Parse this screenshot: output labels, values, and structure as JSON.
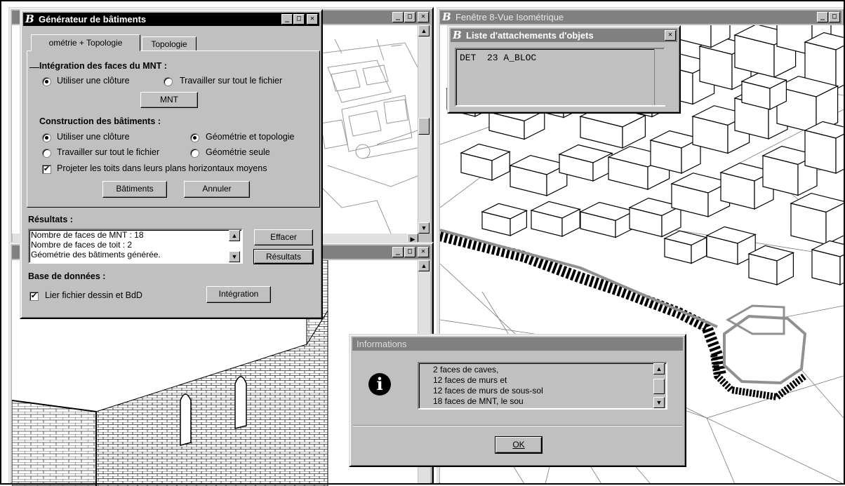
{
  "generator": {
    "title": "Générateur de bâtiments",
    "tabs": [
      "ométrie + Topologie",
      "Topologie"
    ],
    "mnt_section": {
      "title": "Intégration des faces du MNT :",
      "option_fence": "Utiliser une clôture",
      "option_file": "Travailler sur tout le fichier",
      "selected": "Utiliser une clôture",
      "button": "MNT"
    },
    "build_section": {
      "title": "Construction des bâtiments :",
      "option_fence": "Utiliser une clôture",
      "option_file": "Travailler sur tout le fichier",
      "option_geo_topo": "Géométrie et topologie",
      "option_geo_only": "Géométrie seule",
      "project_roofs": "Projeter les toits dans leurs plans horizontaux moyens",
      "project_roofs_checked": true,
      "button_build": "Bâtiments",
      "button_cancel": "Annuler"
    },
    "results": {
      "title": "Résultats :",
      "lines": [
        "Nombre de faces de MNT : 18",
        "Nombre de faces de toit : 2",
        "Géométrie des bâtiments générée."
      ],
      "button_clear": "Effacer",
      "button_results": "Résultats"
    },
    "database": {
      "title": "Base de données :",
      "link_label": "Lier fichier dessin et BdD",
      "link_checked": true,
      "button_integration": "Intégration"
    }
  },
  "iso_window": {
    "title": "Fenêtre 8-Vue Isométrique"
  },
  "attach_list": {
    "title": "Liste d'attachements d'objets",
    "items": [
      "DET  23 A_BLOC"
    ]
  },
  "info_dialog": {
    "title": "Informations",
    "lines": [
      "2 faces de caves,",
      "12 faces de murs et",
      "12 faces de murs de sous-sol",
      "18 faces de MNT, le sou"
    ],
    "ok": "OK"
  },
  "colors": {
    "titlebar_active": "#000000",
    "titlebar_inactive": "#808080",
    "face": "#c0c0c0"
  }
}
